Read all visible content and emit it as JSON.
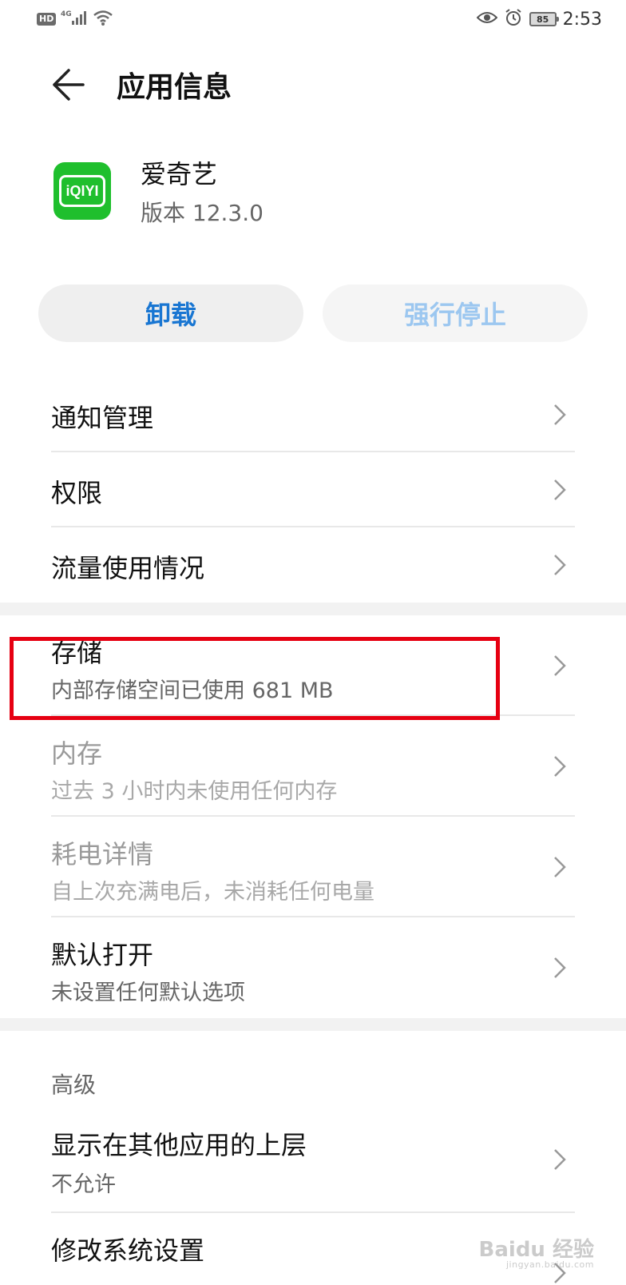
{
  "status_bar": {
    "hd": "HD",
    "network": "4G",
    "battery": "85",
    "time": "2:53"
  },
  "header": {
    "title": "应用信息"
  },
  "app": {
    "name": "爱奇艺",
    "version": "版本 12.3.0",
    "icon_text": "iQIYI",
    "icon_color": "#1fbf2d"
  },
  "actions": {
    "uninstall": "卸载",
    "force_stop": "强行停止"
  },
  "group1": [
    {
      "title": "通知管理"
    },
    {
      "title": "权限"
    },
    {
      "title": "流量使用情况"
    }
  ],
  "group2": [
    {
      "title": "存储",
      "sub": "内部存储空间已使用 681 MB"
    },
    {
      "title": "内存",
      "sub": "过去 3 小时内未使用任何内存"
    },
    {
      "title": "耗电详情",
      "sub": "自上次充满电后，未消耗任何电量"
    },
    {
      "title": "默认打开",
      "sub": "未设置任何默认选项"
    }
  ],
  "advanced": {
    "header": "高级",
    "items": [
      {
        "title": "显示在其他应用的上层",
        "sub": "不允许"
      },
      {
        "title": "修改系统设置"
      }
    ]
  },
  "watermark": {
    "brand": "Baidu 经验",
    "url": "jingyan.baidu.com"
  },
  "colors": {
    "accent": "#1976d2",
    "highlight": "#e60012"
  }
}
